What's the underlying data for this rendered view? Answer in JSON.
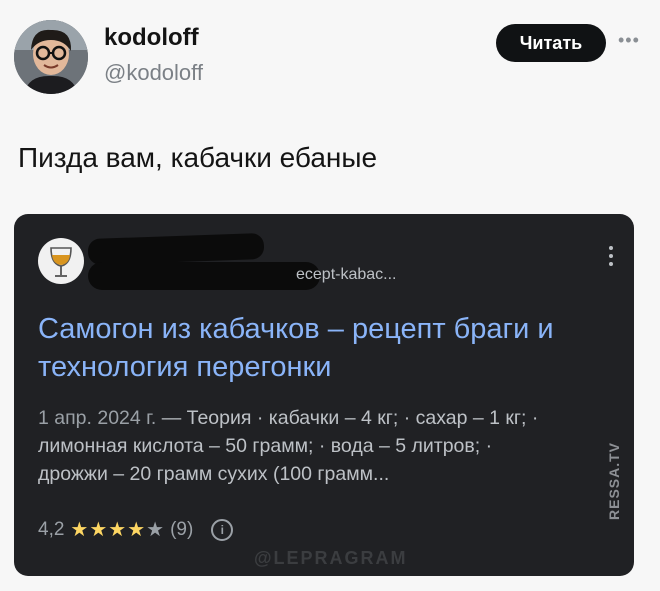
{
  "tweet": {
    "author_name": "kodoloff",
    "author_handle": "@kodoloff",
    "read_button": "Читать",
    "more_icon": "more-horizontal-icon",
    "text": "Пизда вам, кабачки ебаные"
  },
  "search_result": {
    "url": "ecept-kabac...",
    "site_icon": "wine-glass-icon",
    "title_line1": "Самогон из кабачков – рецепт браги и",
    "title_line2": "технология перегонки",
    "date": "1 апр. 2024 г.",
    "snippet_line1_rest": " — Теория · кабачки – 4 кг; · сахар – 1 кг; ·",
    "snippet_line2": "лимонная кислота – 50 грамм; · вода – 5 литров; ·",
    "snippet_line3": "дрожжи – 20 грамм сухих (100 грамм...",
    "rating_value": "4,2",
    "rating_stars": 4,
    "rating_count": "(9)",
    "star_color": "#fdd663",
    "empty_star_color": "#9aa0a6",
    "title_color": "#8ab4f8"
  },
  "watermarks": {
    "bottom": "@LEPRAGRAM",
    "side": "RESSA.TV"
  }
}
